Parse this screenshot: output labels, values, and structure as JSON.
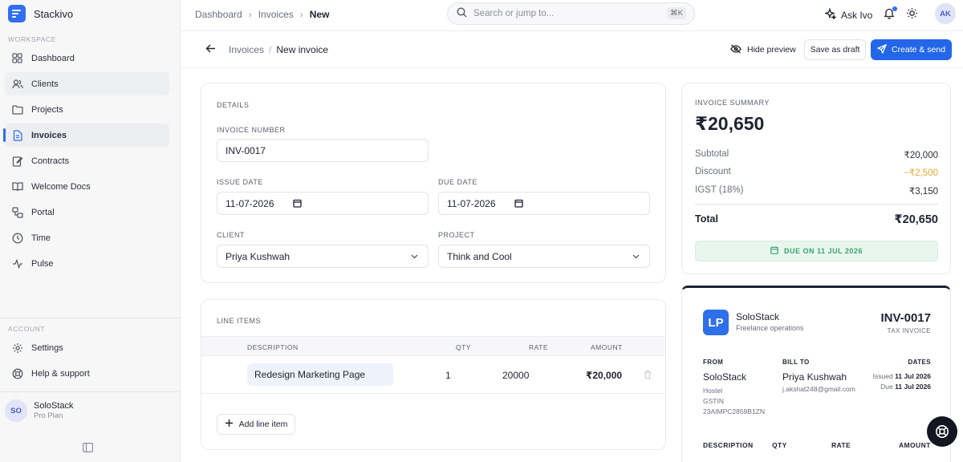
{
  "app": {
    "name": "Stackivo"
  },
  "sidebar": {
    "workspace_label": "WORKSPACE",
    "items": [
      {
        "label": "Dashboard",
        "icon": "grid-icon"
      },
      {
        "label": "Clients",
        "icon": "users-icon"
      },
      {
        "label": "Projects",
        "icon": "folder-icon"
      },
      {
        "label": "Invoices",
        "icon": "file-icon"
      },
      {
        "label": "Contracts",
        "icon": "pen-icon"
      },
      {
        "label": "Welcome Docs",
        "icon": "book-icon"
      },
      {
        "label": "Portal",
        "icon": "portal-icon"
      },
      {
        "label": "Time",
        "icon": "clock-icon"
      },
      {
        "label": "Pulse",
        "icon": "pulse-icon"
      }
    ],
    "account_label": "ACCOUNT",
    "account_items": [
      {
        "label": "Settings",
        "icon": "gear-icon"
      },
      {
        "label": "Help & support",
        "icon": "lifebuoy-icon"
      }
    ],
    "user": {
      "initials": "SO",
      "name": "SoloStack",
      "plan": "Pro Plan"
    }
  },
  "topbar": {
    "breadcrumbs": [
      "Dashboard",
      "Invoices",
      "New"
    ],
    "search_placeholder": "Search or jump to...",
    "search_shortcut": "⌘K",
    "ask_label": "Ask Ivo",
    "avatar_initials": "AK"
  },
  "page": {
    "breadcrumb_parent": "Invoices",
    "breadcrumb_current": "New invoice",
    "hide_preview_label": "Hide preview",
    "save_draft_label": "Save as draft",
    "create_send_label": "Create & send"
  },
  "details": {
    "title": "DETAILS",
    "invoice_number_label": "INVOICE NUMBER",
    "invoice_number": "INV-0017",
    "issue_date_label": "ISSUE DATE",
    "issue_date": "11-07-2026",
    "due_date_label": "DUE DATE",
    "due_date": "11-07-2026",
    "client_label": "CLIENT",
    "client": "Priya Kushwah",
    "project_label": "PROJECT",
    "project": "Think and Cool"
  },
  "line_items": {
    "title": "LINE ITEMS",
    "columns": [
      "DESCRIPTION",
      "QTY",
      "RATE",
      "AMOUNT"
    ],
    "rows": [
      {
        "description": "Redesign Marketing Page",
        "qty": "1",
        "rate": "20000",
        "amount": "₹20,000"
      }
    ],
    "add_label": "Add line item"
  },
  "summary": {
    "title": "INVOICE SUMMARY",
    "total_big": "₹20,650",
    "subtotal_label": "Subtotal",
    "subtotal": "₹20,000",
    "discount_label": "Discount",
    "discount": "−₹2,500",
    "tax_label": "IGST (18%)",
    "tax": "₹3,150",
    "total_label": "Total",
    "total": "₹20,650",
    "due_badge": "DUE ON 11 JUL 2026"
  },
  "preview": {
    "logo_text": "LP",
    "company": "SoloStack",
    "tagline": "Freelance operations",
    "invoice_number": "INV-0017",
    "invoice_type": "TAX INVOICE",
    "from_label": "FROM",
    "from_name": "SoloStack",
    "from_line1": "Hostel",
    "from_line2": "GSTIN",
    "from_line3": "23AIMPC2859B1ZN",
    "bill_to_label": "BILL TO",
    "bill_to_name": "Priya Kushwah",
    "bill_to_email": "j.akshat248@gmail.com",
    "dates_label": "DATES",
    "issued_label": "Issued",
    "issued": "11 Jul 2026",
    "due_label": "Due",
    "due": "11 Jul 2026",
    "columns": [
      "DESCRIPTION",
      "QTY",
      "RATE",
      "AMOUNT"
    ]
  },
  "colors": {
    "accent": "#2366e8",
    "due_green": "#3aa46b",
    "discount": "#e0a82e"
  }
}
